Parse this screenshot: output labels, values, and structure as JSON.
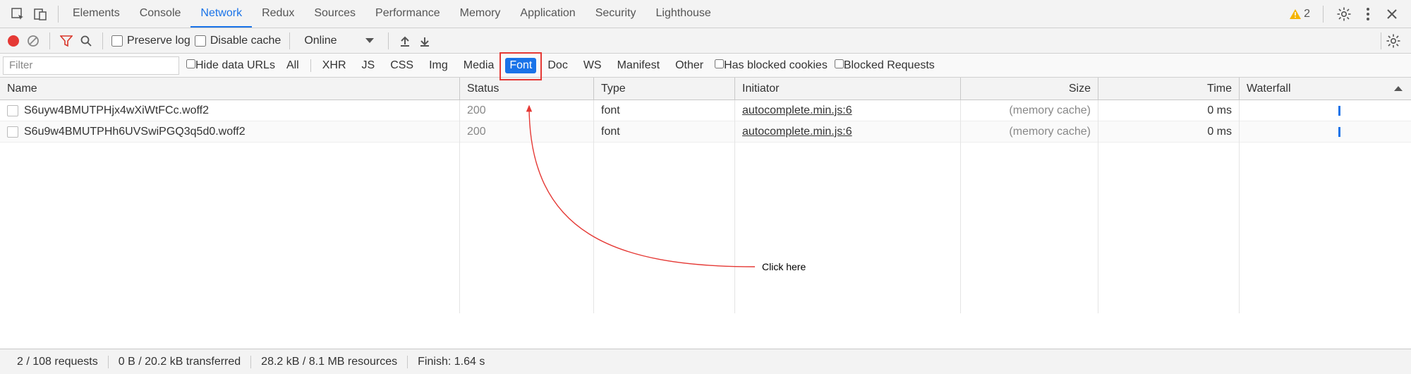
{
  "tabs": [
    "Elements",
    "Console",
    "Network",
    "Redux",
    "Sources",
    "Performance",
    "Memory",
    "Application",
    "Security",
    "Lighthouse"
  ],
  "active_tab_index": 2,
  "warning_count": "2",
  "toolbar": {
    "preserve_log": "Preserve log",
    "disable_cache": "Disable cache",
    "online": "Online"
  },
  "filter": {
    "placeholder": "Filter",
    "hide_data_urls": "Hide data URLs",
    "chips": [
      "All",
      "XHR",
      "JS",
      "CSS",
      "Img",
      "Media",
      "Font",
      "Doc",
      "WS",
      "Manifest",
      "Other"
    ],
    "selected_chip_index": 6,
    "has_blocked_cookies": "Has blocked cookies",
    "blocked_requests": "Blocked Requests"
  },
  "columns": [
    "Name",
    "Status",
    "Type",
    "Initiator",
    "Size",
    "Time",
    "Waterfall"
  ],
  "rows": [
    {
      "name": "S6uyw4BMUTPHjx4wXiWtFCc.woff2",
      "status": "200",
      "type": "font",
      "initiator": "autocomplete.min.js:6",
      "size": "(memory cache)",
      "time": "0 ms"
    },
    {
      "name": "S6u9w4BMUTPHh6UVSwiPGQ3q5d0.woff2",
      "status": "200",
      "type": "font",
      "initiator": "autocomplete.min.js:6",
      "size": "(memory cache)",
      "time": "0 ms"
    }
  ],
  "status": {
    "requests": "2 / 108 requests",
    "transferred": "0 B / 20.2 kB transferred",
    "resources": "28.2 kB / 8.1 MB resources",
    "finish": "Finish: 1.64 s"
  },
  "annotation": {
    "label": "Click here"
  }
}
